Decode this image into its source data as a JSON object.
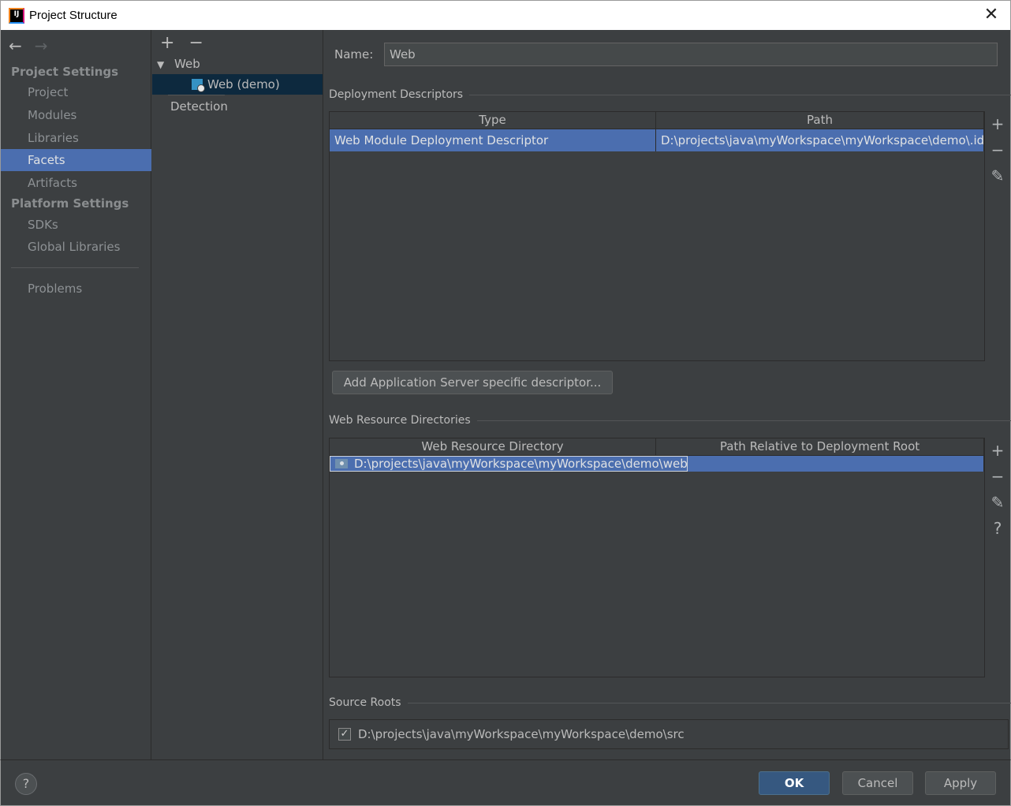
{
  "window": {
    "title": "Project Structure",
    "app_icon_text": "IJ"
  },
  "nav": {
    "back_glyph": "←",
    "forward_glyph": "→",
    "project_settings_label": "Project Settings",
    "platform_settings_label": "Platform Settings",
    "items": [
      {
        "label": "Project"
      },
      {
        "label": "Modules"
      },
      {
        "label": "Libraries"
      },
      {
        "label": "Facets",
        "selected": true
      },
      {
        "label": "Artifacts"
      },
      {
        "label": "SDKs"
      },
      {
        "label": "Global Libraries"
      },
      {
        "label": "Problems"
      }
    ]
  },
  "tree": {
    "add_glyph": "+",
    "remove_glyph": "−",
    "root_label": "Web",
    "child_label": "Web (demo)",
    "detection_label": "Detection"
  },
  "facet": {
    "name_label": "Name:",
    "name_value": "Web",
    "deployment": {
      "title": "Deployment Descriptors",
      "columns": [
        "Type",
        "Path"
      ],
      "rows": [
        {
          "type": "Web Module Deployment Descriptor",
          "path": "D:\\projects\\java\\myWorkspace\\myWorkspace\\demo\\.idea"
        }
      ],
      "add_server_button": "Add Application Server specific descriptor..."
    },
    "resources": {
      "title": "Web Resource Directories",
      "columns": [
        "Web Resource Directory",
        "Path Relative to Deployment Root"
      ],
      "rows": [
        {
          "dir": "D:\\projects\\java\\myWorkspace\\myWorkspace\\demo\\web",
          "relative": ""
        }
      ]
    },
    "source_roots": {
      "title": "Source Roots",
      "items": [
        {
          "checked": true,
          "check_glyph": "✓",
          "path": "D:\\projects\\java\\myWorkspace\\myWorkspace\\demo\\src"
        }
      ]
    }
  },
  "tools": {
    "add": "+",
    "remove": "−",
    "edit": "✎",
    "help": "?"
  },
  "footer": {
    "help_label": "?",
    "ok_label": "OK",
    "cancel_label": "Cancel",
    "apply_label": "Apply"
  },
  "colors": {
    "background": "#3c3f41",
    "selection": "#4b6eaf",
    "tree_selection": "#0d293e",
    "primary_button": "#365880"
  }
}
